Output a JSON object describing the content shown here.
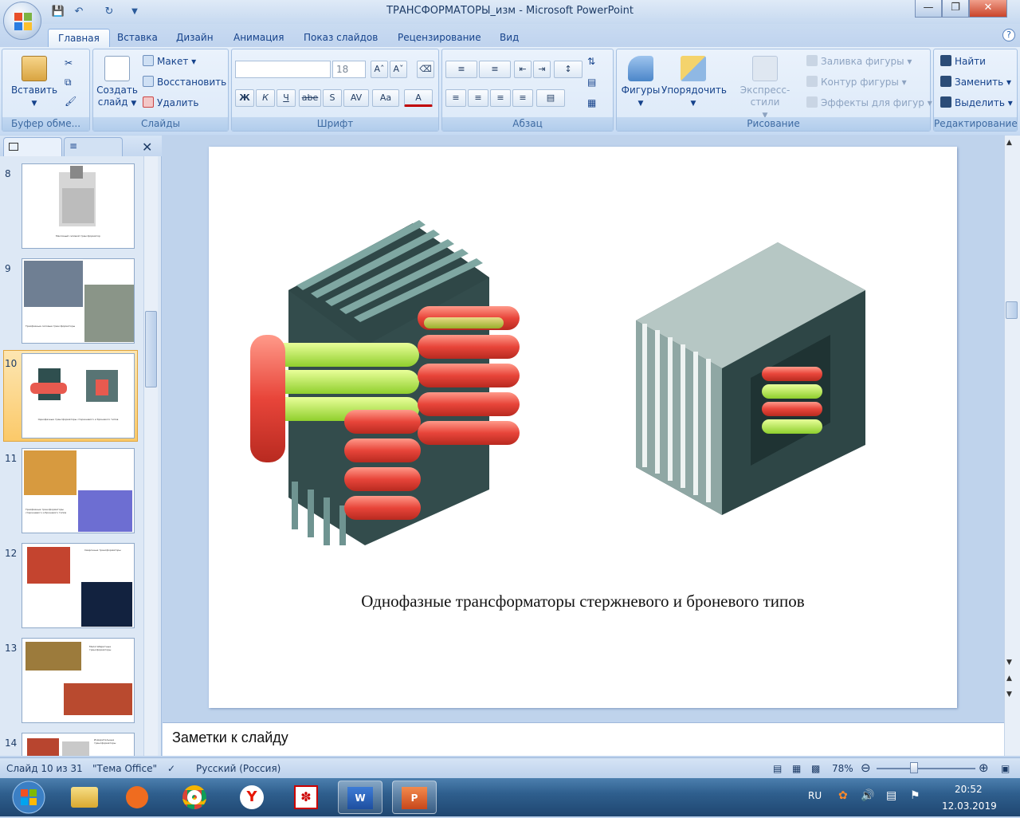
{
  "window": {
    "title": "ТРАНСФОРМАТОРЫ_изм - Microsoft PowerPoint"
  },
  "tabs": [
    "Главная",
    "Вставка",
    "Дизайн",
    "Анимация",
    "Показ слайдов",
    "Рецензирование",
    "Вид"
  ],
  "ribbon": {
    "clipboard": {
      "label": "Буфер обме...",
      "paste": "Вставить"
    },
    "slides": {
      "label": "Слайды",
      "new_slide_1": "Создать",
      "new_slide_2": "слайд",
      "layout": "Макет",
      "reset": "Восстановить",
      "delete": "Удалить"
    },
    "font": {
      "label": "Шрифт",
      "font_name": "",
      "font_size": "18",
      "bold": "Ж",
      "italic": "К",
      "underline": "Ч",
      "strike": "abe",
      "shadow": "S",
      "spacing": "AV",
      "case": "Aa"
    },
    "paragraph": {
      "label": "Абзац"
    },
    "drawing": {
      "label": "Рисование",
      "shapes": "Фигуры",
      "arrange": "Упорядочить",
      "quick_styles": "Экспресс-стили",
      "fill": "Заливка фигуры",
      "outline": "Контур фигуры",
      "effects": "Эффекты для фигур"
    },
    "editing": {
      "label": "Редактирование",
      "find": "Найти",
      "replace": "Заменить",
      "select": "Выделить"
    }
  },
  "thumbnails": [
    {
      "num": "8",
      "caption": "Масляный силовой трансформатор"
    },
    {
      "num": "9",
      "caption": "Трехфазные силовые трансформаторы"
    },
    {
      "num": "10",
      "caption": "Однофазные трансформаторы стержневого и броневого типов"
    },
    {
      "num": "11",
      "caption": "Трехфазные трансформаторы стержневого и броневого типов"
    },
    {
      "num": "12",
      "caption": "Сварочные трансформаторы"
    },
    {
      "num": "13",
      "caption": "Малогабаритные трансформаторы"
    },
    {
      "num": "14",
      "caption": "Измерительные трансформаторы"
    }
  ],
  "slide": {
    "caption": "Однофазные трансформаторы стержневого и броневого типов"
  },
  "notes": {
    "placeholder": "Заметки к слайду"
  },
  "status": {
    "slide": "Слайд 10 из 31",
    "theme": "\"Тема Office\"",
    "language": "Русский (Россия)",
    "zoom": "78%"
  },
  "tray": {
    "lang": "RU",
    "time": "20:52",
    "date": "12.03.2019"
  }
}
